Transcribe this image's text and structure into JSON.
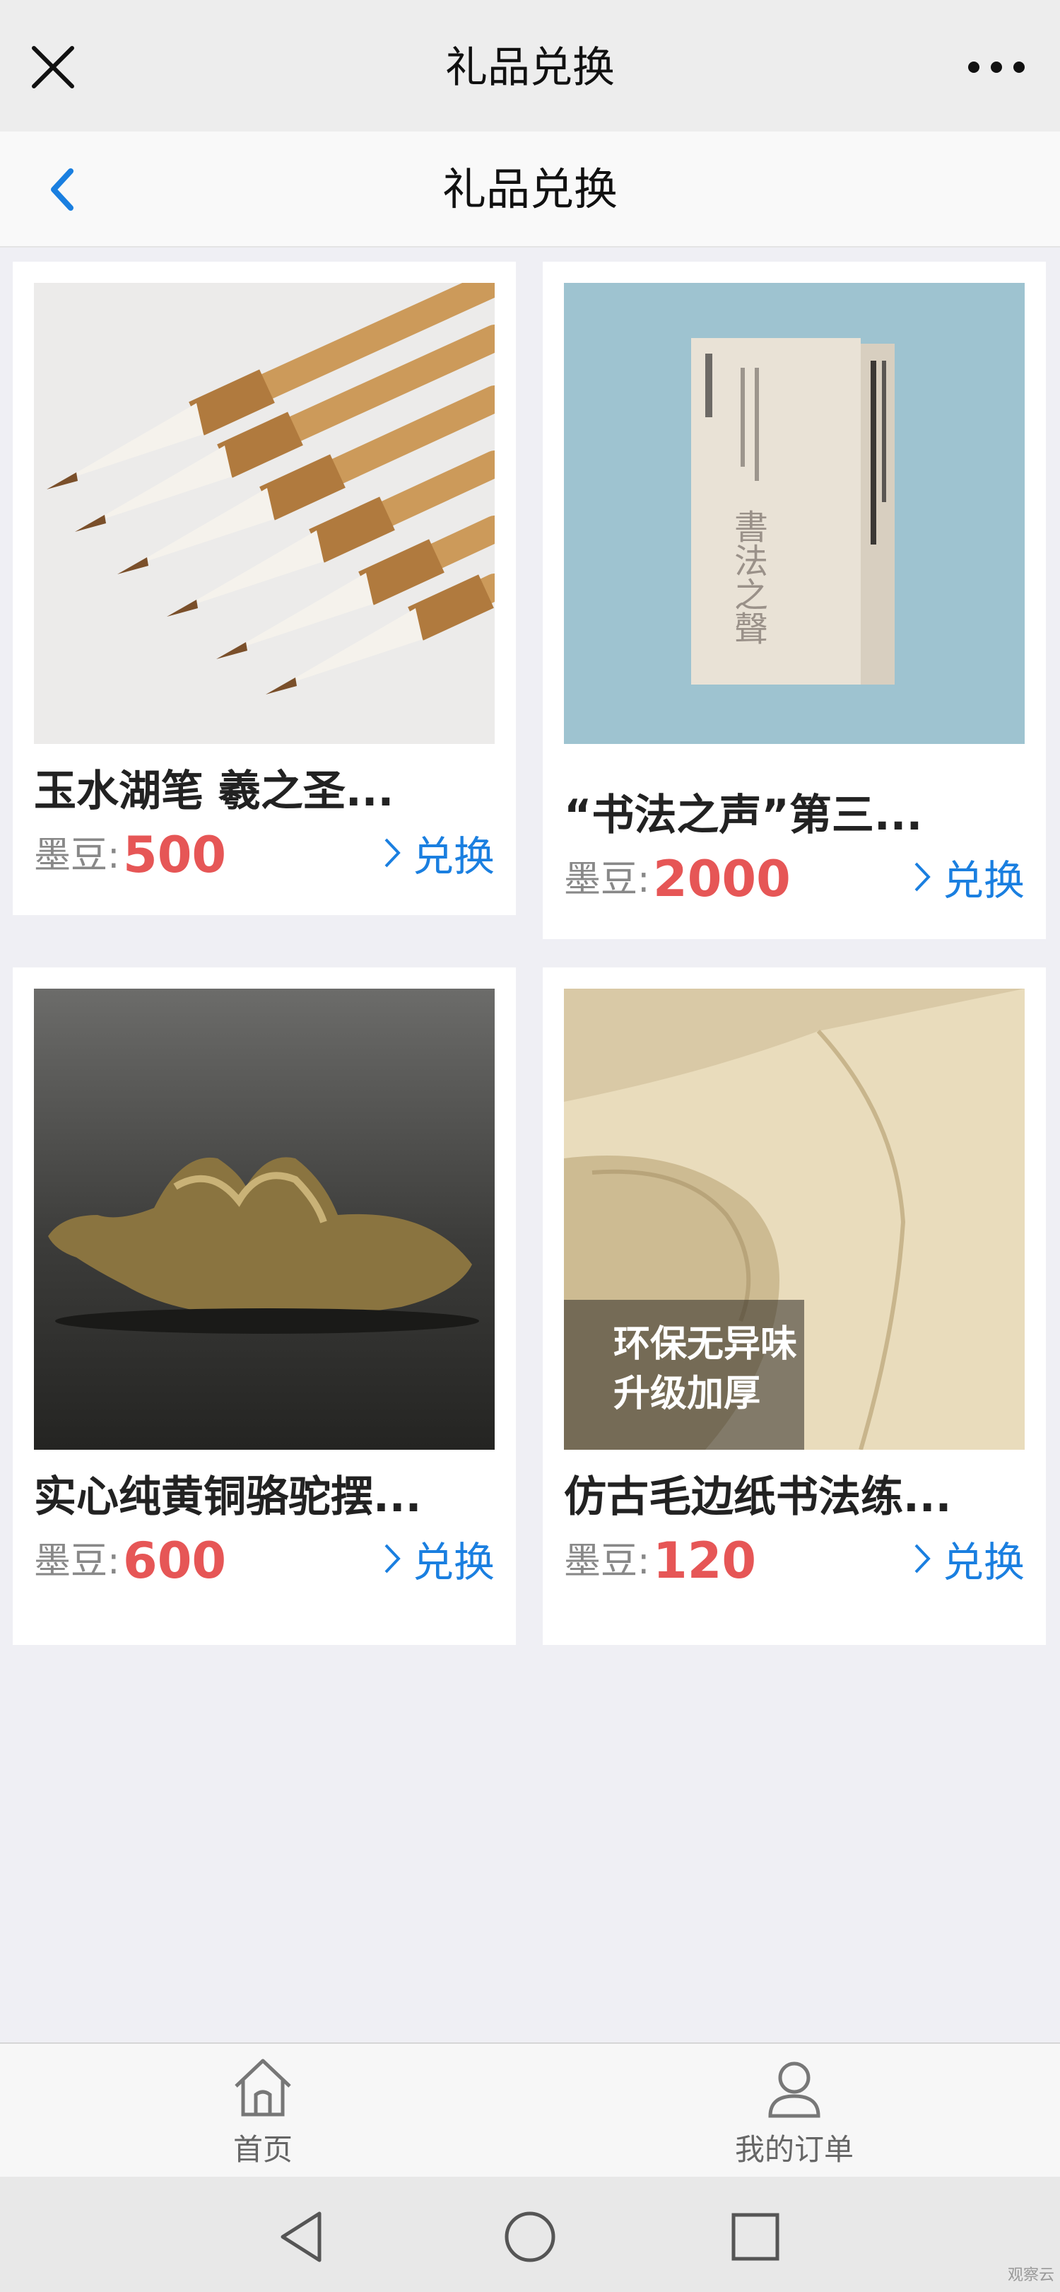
{
  "top_bar": {
    "title": "礼品兑换",
    "close_icon": "close-icon",
    "more_icon": "more-icon"
  },
  "header": {
    "title": "礼品兑换",
    "back_icon": "chevron-left-icon",
    "accent": "#1a7fe0"
  },
  "products": [
    {
      "name": "玉水湖笔 羲之圣...",
      "price_label": "墨豆:",
      "price": "500",
      "action": "兑换"
    },
    {
      "name": "“书法之声”第三...",
      "price_label": "墨豆:",
      "price": "2000",
      "action": "兑换",
      "book_cover_text": "書法之聲"
    },
    {
      "name": "实心纯黄铜骆驼摆...",
      "price_label": "墨豆:",
      "price": "600",
      "action": "兑换"
    },
    {
      "name": "仿古毛边纸书法练...",
      "price_label": "墨豆:",
      "price": "120",
      "action": "兑换",
      "image_caption_1": "环保无异味",
      "image_caption_2": "升级加厚"
    }
  ],
  "tabs": [
    {
      "label": "首页",
      "icon": "home-icon"
    },
    {
      "label": "我的订单",
      "icon": "user-icon"
    }
  ],
  "system_nav": {
    "back_icon": "triangle-back-icon",
    "home_icon": "circle-home-icon",
    "recents_icon": "square-recents-icon"
  },
  "watermark": "观察云",
  "colors": {
    "price": "#e65656",
    "link": "#1a7fe0",
    "background": "#efeff4"
  }
}
